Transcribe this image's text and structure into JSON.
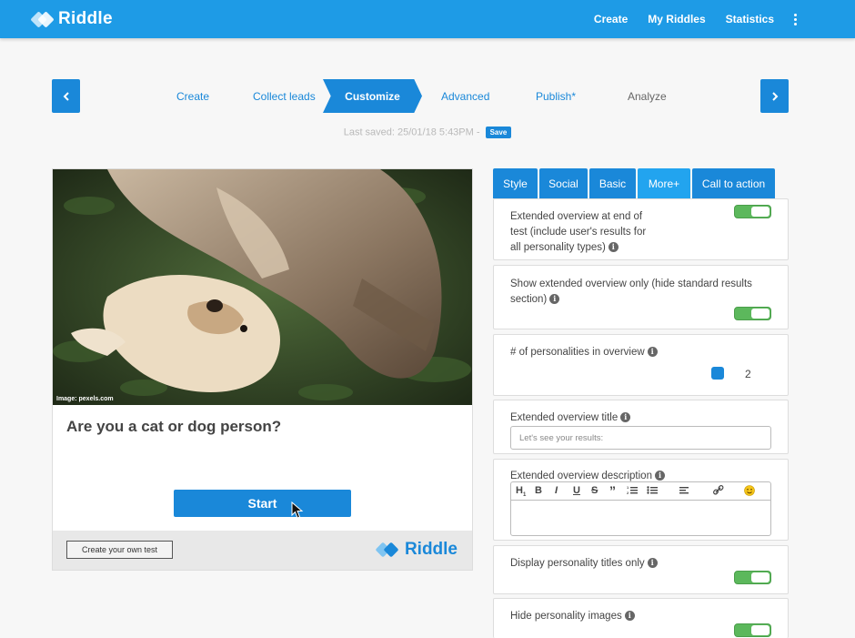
{
  "app": {
    "logo_text": "Riddle"
  },
  "topnav": {
    "items": [
      "Create",
      "My Riddles",
      "Statistics"
    ],
    "more_icon": "kebab-menu-icon"
  },
  "wizard": {
    "prev_icon": "chevron-left-icon",
    "next_icon": "chevron-right-icon",
    "steps": [
      "Create",
      "Collect leads",
      "Customize",
      "Advanced",
      "Publish*",
      "Analyze"
    ],
    "active_step": "Customize",
    "last_saved": "Last saved: 25/01/18 5:43PM  -",
    "save_label": "Save"
  },
  "preview": {
    "photo_credit": "Image: pexels.com",
    "question": "Are you a cat or dog person?",
    "start_label": "Start",
    "create_own_label": "Create your own test",
    "footer_logo_text": "Riddle"
  },
  "settings": {
    "tabs": [
      "Style",
      "Social",
      "Basic",
      "More+",
      "Call to action"
    ],
    "active_tab": "More+",
    "options": {
      "extended_overview_end": {
        "label": "Extended overview at end of test (include user's results for all personality types)",
        "enabled": true
      },
      "extended_overview_only": {
        "label": "Show extended overview only (hide standard results section)",
        "enabled": true
      },
      "personalities_count": {
        "label": "# of personalities in overview",
        "value": "2"
      },
      "overview_title": {
        "label": "Extended overview title",
        "placeholder": "Let's see your results:"
      },
      "overview_description": {
        "label": "Extended overview description",
        "toolbar": [
          "H1",
          "B",
          "I",
          "U",
          "S",
          "”",
          "ordered-list",
          "bullet-list",
          "align-left",
          "link",
          "emoji"
        ]
      },
      "titles_only": {
        "label": "Display personality titles only",
        "enabled": true
      },
      "hide_images": {
        "label": "Hide personality images",
        "enabled": true
      }
    },
    "info_glyph": "i"
  },
  "colors": {
    "brand_blue": "#1e9be6",
    "button_blue": "#1a88d9",
    "toggle_green": "#5cb85c"
  }
}
